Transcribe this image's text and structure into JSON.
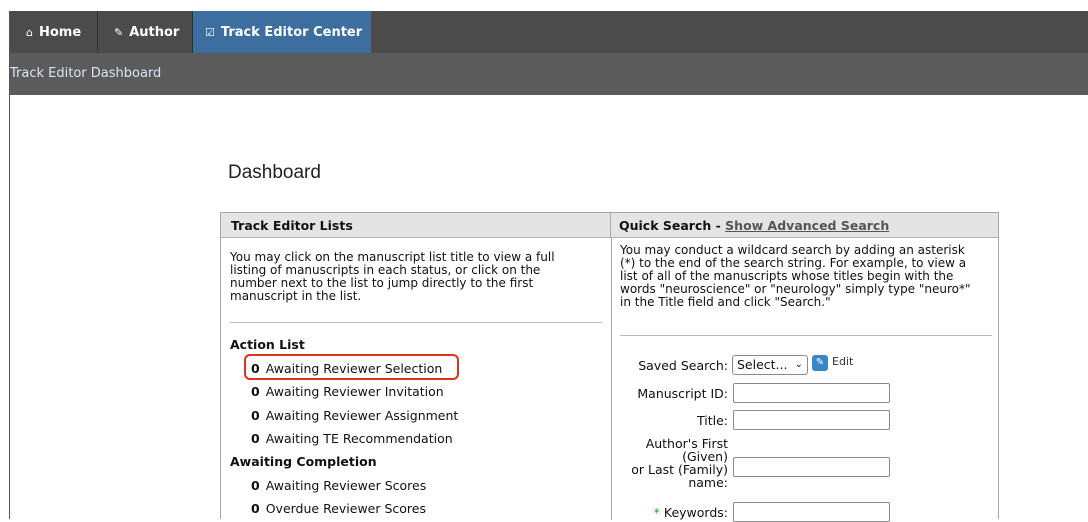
{
  "nav": {
    "home": "Home",
    "author": "Author",
    "track_editor_center": "Track Editor Center"
  },
  "subnav": {
    "dashboard_link": "Track Editor Dashboard"
  },
  "page_title": "Dashboard",
  "left_panel": {
    "header": "Track Editor Lists",
    "intro": [
      "You may click on the manuscript list title to view a full",
      "listing of manuscripts in each status, or click on the",
      "number next to the list to jump directly to the first",
      "manuscript in the list."
    ],
    "sections": [
      {
        "title": "Action List",
        "items": [
          {
            "count": "0",
            "label": "Awaiting Reviewer Selection"
          },
          {
            "count": "0",
            "label": "Awaiting Reviewer Invitation"
          },
          {
            "count": "0",
            "label": "Awaiting Reviewer Assignment"
          },
          {
            "count": "0",
            "label": "Awaiting TE Recommendation"
          }
        ]
      },
      {
        "title": "Awaiting Completion",
        "items": [
          {
            "count": "0",
            "label": "Awaiting Reviewer Scores"
          },
          {
            "count": "0",
            "label": "Overdue Reviewer Scores"
          }
        ]
      }
    ]
  },
  "right_panel": {
    "header_prefix": "Quick Search - ",
    "header_link": "Show Advanced Search",
    "intro": [
      "You may conduct a wildcard search by adding an asterisk",
      "(*) to the end of the search string. For example, to view a",
      "list of all of the manuscripts whose titles begin with the",
      "words \"neuroscience\" or \"neurology\" simply type \"neuro*\"",
      "in the Title field and click \"Search.\""
    ],
    "saved_search_label": "Saved Search:",
    "saved_search_value": "Select...",
    "edit_label": "Edit",
    "fields": {
      "manuscript_id": "Manuscript ID:",
      "title": "Title:",
      "author_name": [
        "Author's First",
        "(Given)",
        "or Last (Family)",
        "name:"
      ],
      "keywords_star": "*",
      "keywords": "Keywords:"
    }
  },
  "icons": {
    "home": "home-icon",
    "author": "pencil-icon",
    "track_editor": "checkbox-icon",
    "select": "chevron-down-icon",
    "edit": "pencil-edit-icon"
  },
  "colors": {
    "nav_bg": "#4b4b4b",
    "nav_active": "#3c6ea0",
    "subnav_bg": "#5b5b5b",
    "highlight": "#e0301e",
    "required_star": "#2a9d2a"
  }
}
